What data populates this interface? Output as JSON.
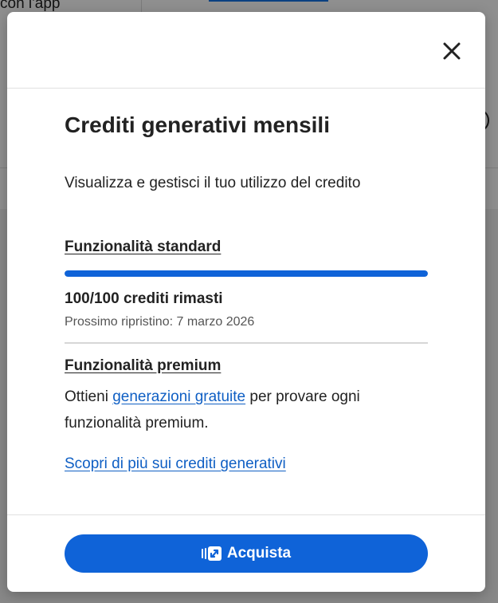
{
  "background": {
    "partial_text": "con l'app"
  },
  "modal": {
    "title": "Crediti generativi mensili",
    "subtitle": "Visualizza e gestisci il tuo utilizzo del credito",
    "standard": {
      "heading": "Funzionalità standard",
      "progress_fraction": 1.0,
      "credits_text": "100/100 crediti rimasti",
      "reset_text": "Prossimo ripristino: 7 marzo 2026"
    },
    "premium": {
      "heading": "Funzionalità premium",
      "text_before": "Ottieni ",
      "link_text": "generazioni gratuite",
      "text_after": " per provare ogni funzionalità premium."
    },
    "learn_more_link": "Scopri di più sui crediti generativi",
    "buy_button_label": "Acquista"
  },
  "colors": {
    "accent": "#0f63d8",
    "link": "#0f5fc4",
    "text": "#222222"
  },
  "icons": {
    "close": "close-icon",
    "buy": "credits-card-icon"
  }
}
